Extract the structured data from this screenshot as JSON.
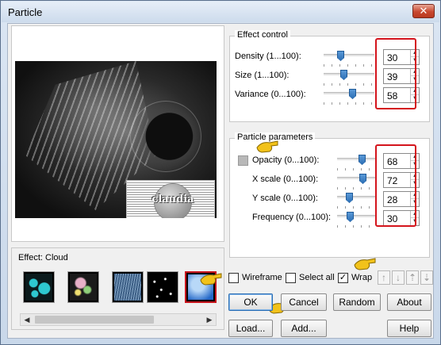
{
  "window": {
    "title": "Particle",
    "close_glyph": "✕"
  },
  "preview": {
    "watermark_text": "claudia"
  },
  "effect": {
    "label": "Effect: Cloud",
    "thumbnails": [
      {
        "name": "bubbles-thumbnail",
        "colors": [
          "#0b1a1c",
          "#2ec8d0"
        ]
      },
      {
        "name": "sparkles-thumbnail",
        "colors": [
          "#1a1a1a",
          "#e8b0c8"
        ]
      },
      {
        "name": "rain-thumbnail",
        "colors": [
          "#3d5f86",
          "#88a8c8"
        ]
      },
      {
        "name": "snow-thumbnail",
        "colors": [
          "#000000",
          "#ffffff"
        ]
      },
      {
        "name": "cloud-thumbnail",
        "colors": [
          "#2468c8",
          "#b8d8f8"
        ]
      }
    ],
    "scroll_left": "◀",
    "scroll_right": "▶"
  },
  "effect_control": {
    "title": "Effect control",
    "rows": [
      {
        "label": "Density (1...100):",
        "value": "30",
        "level": 0.3
      },
      {
        "label": "Size (1...100):",
        "value": "39",
        "level": 0.39
      },
      {
        "label": "Variance (0...100):",
        "value": "58",
        "level": 0.58
      }
    ]
  },
  "particle_parameters": {
    "title": "Particle parameters",
    "rows": [
      {
        "label": "Opacity (0...100):",
        "value": "68",
        "level": 0.68
      },
      {
        "label": "X scale (0...100):",
        "value": "72",
        "level": 0.72
      },
      {
        "label": "Y scale (0...100):",
        "value": "28",
        "level": 0.28
      },
      {
        "label": "Frequency (0...100):",
        "value": "30",
        "level": 0.3
      }
    ]
  },
  "options": {
    "wireframe": {
      "label": "Wireframe",
      "checked": false
    },
    "select_all": {
      "label": "Select all",
      "checked": false
    },
    "wrap": {
      "label": "Wrap",
      "checked": true
    },
    "check_glyph": "✓"
  },
  "arrows": [
    "↑",
    "↓",
    "⇡",
    "⇣"
  ],
  "buttons": {
    "ok": "OK",
    "cancel": "Cancel",
    "random": "Random",
    "about": "About",
    "load": "Load...",
    "add": "Add...",
    "help": "Help"
  },
  "spin_glyphs": {
    "up": "▲",
    "down": "▼"
  },
  "colors": {
    "highlight_red": "#d4141c",
    "pointer_yellow": "#f2c21a",
    "slider_blue": "#2d6fb4"
  }
}
